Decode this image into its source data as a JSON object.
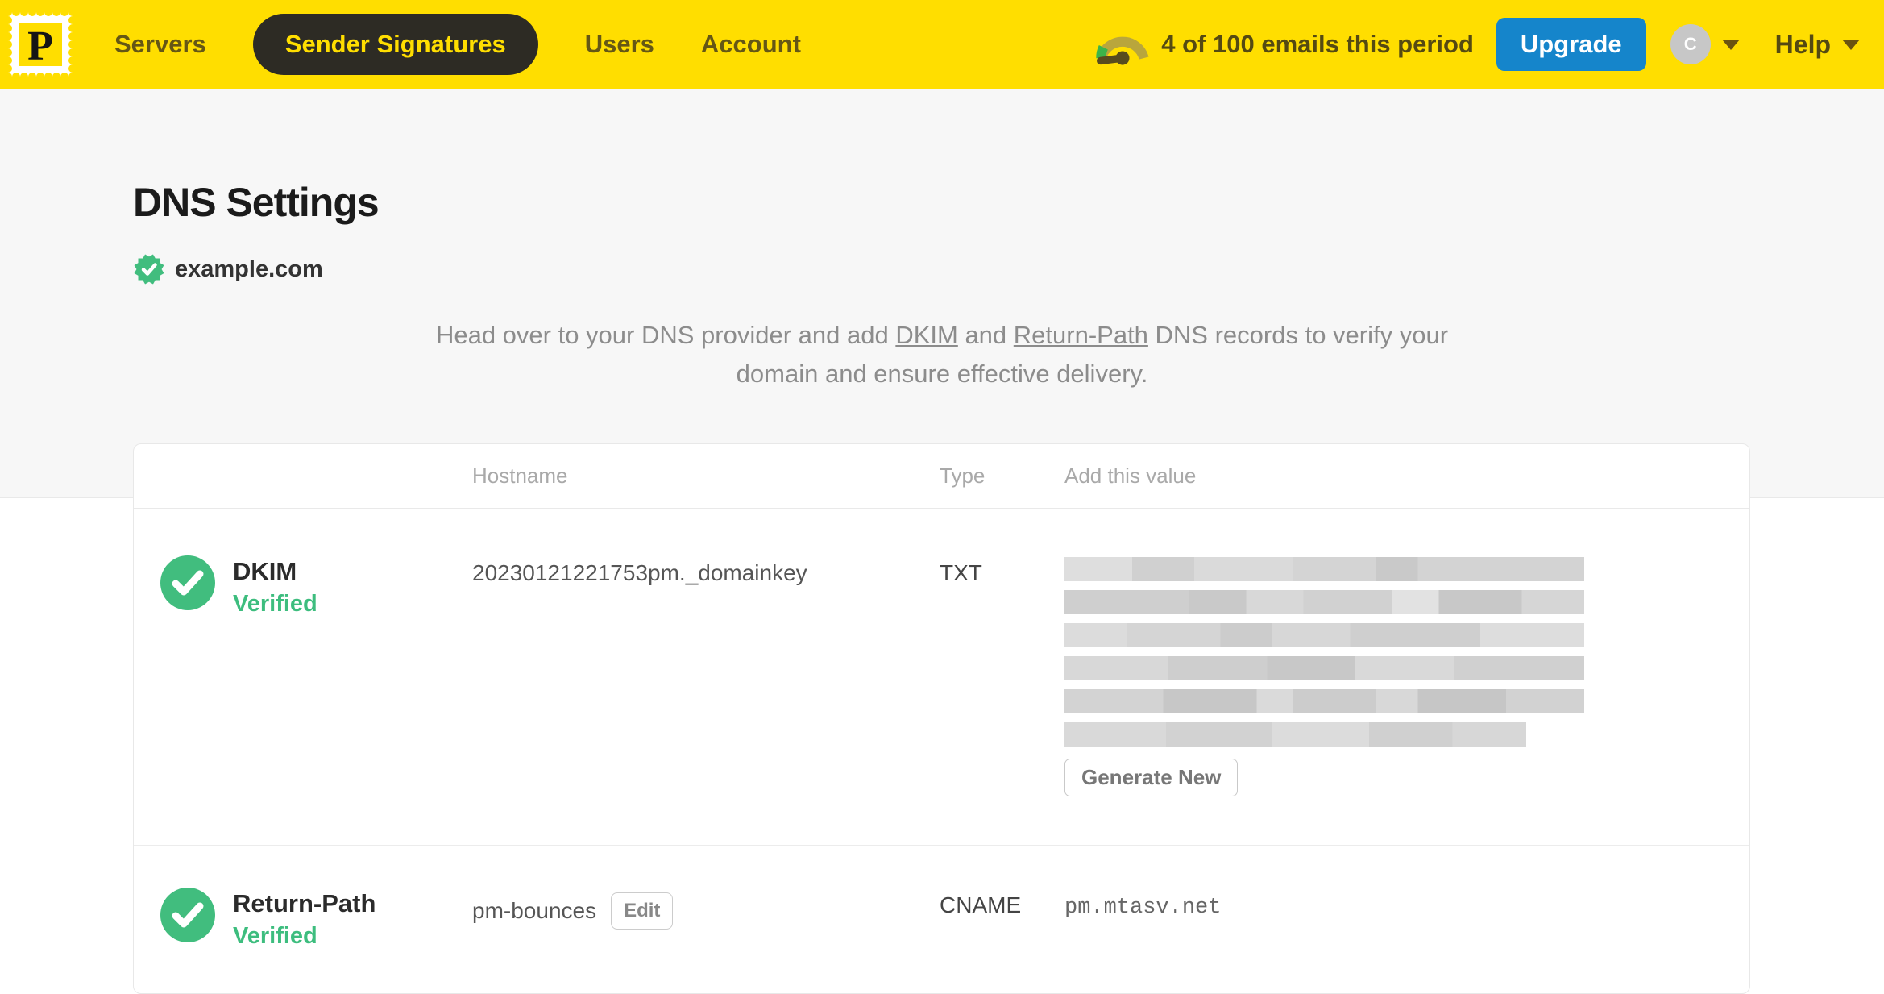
{
  "nav": {
    "brand_letter": "P",
    "items": [
      {
        "label": "Servers",
        "active": false
      },
      {
        "label": "Sender Signatures",
        "active": true
      },
      {
        "label": "Users",
        "active": false
      },
      {
        "label": "Account",
        "active": false
      }
    ],
    "usage_text": "4 of 100 emails this period",
    "upgrade_label": "Upgrade",
    "avatar_initial": "C",
    "help_label": "Help"
  },
  "page": {
    "title": "DNS Settings",
    "domain": "example.com",
    "description": {
      "part1": "Head over to your DNS provider and add ",
      "link_dkim": "DKIM",
      "part2": " and ",
      "link_return_path": "Return-Path",
      "part3": " DNS records to verify your domain and ensure effective delivery."
    }
  },
  "table": {
    "headers": {
      "hostname": "Hostname",
      "type": "Type",
      "value": "Add this value"
    },
    "rows": [
      {
        "name": "DKIM",
        "status": "Verified",
        "hostname": "20230121221753pm._domainkey",
        "type": "TXT",
        "value_redacted": true,
        "action_label": "Generate New"
      },
      {
        "name": "Return-Path",
        "status": "Verified",
        "hostname": "pm-bounces",
        "edit_label": "Edit",
        "type": "CNAME",
        "value": "pm.mtasv.net"
      }
    ]
  },
  "colors": {
    "brand_yellow": "#ffde00",
    "active_pill": "#2d2b24",
    "upgrade_blue": "#1585cb",
    "verified_green": "#3dbd7e",
    "page_gray": "#f7f7f7"
  }
}
